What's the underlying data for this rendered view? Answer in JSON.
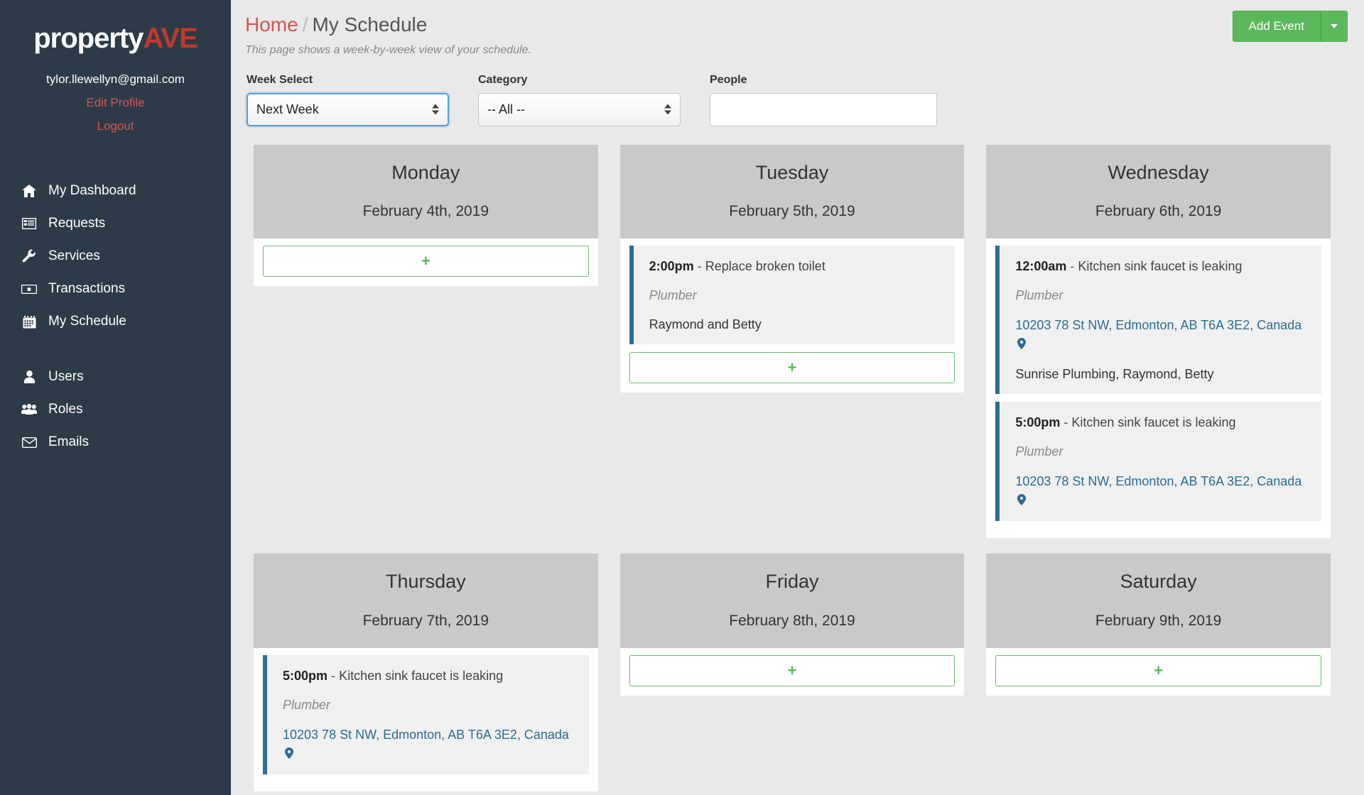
{
  "sidebar": {
    "brand": {
      "part1": "property",
      "part2": "AVE"
    },
    "user_email": "tylor.llewellyn@gmail.com",
    "edit_profile_label": "Edit Profile",
    "logout_label": "Logout",
    "items": [
      {
        "label": "My Dashboard",
        "icon": "home-icon"
      },
      {
        "label": "Requests",
        "icon": "list-alt-icon"
      },
      {
        "label": "Services",
        "icon": "wrench-icon"
      },
      {
        "label": "Transactions",
        "icon": "money-bill-icon"
      },
      {
        "label": "My Schedule",
        "icon": "calendar-icon"
      }
    ],
    "items2": [
      {
        "label": "Users",
        "icon": "user-icon"
      },
      {
        "label": "Roles",
        "icon": "users-icon"
      },
      {
        "label": "Emails",
        "icon": "envelope-icon"
      }
    ]
  },
  "header": {
    "breadcrumb_home": "Home",
    "breadcrumb_sep": "/",
    "breadcrumb_current": "My Schedule",
    "description": "This page shows a week-by-week view of your schedule.",
    "add_event_label": "Add Event"
  },
  "filters": {
    "week_select": {
      "label": "Week Select",
      "value": "Next Week"
    },
    "category": {
      "label": "Category",
      "value": "-- All --"
    },
    "people": {
      "label": "People",
      "value": "",
      "placeholder": ""
    }
  },
  "add_slot_label": "+",
  "colors": {
    "sidebar_bg": "#2d3b48",
    "brand_accent": "#c0392b",
    "link_red": "#d9534f",
    "success_green": "#5cb85c",
    "event_accent": "#2d6e93",
    "day_head_bg": "#c9c9c9",
    "page_bg": "#e9e9e9"
  },
  "days": [
    {
      "name": "Monday",
      "date": "February 4th, 2019",
      "events": [],
      "has_add": true
    },
    {
      "name": "Tuesday",
      "date": "February 5th, 2019",
      "events": [
        {
          "time": "2:00pm",
          "dash": "-",
          "title": "Replace broken toilet",
          "category": "Plumber",
          "address": "",
          "people": "Raymond and Betty"
        }
      ],
      "has_add": true
    },
    {
      "name": "Wednesday",
      "date": "February 6th, 2019",
      "events": [
        {
          "time": "12:00am",
          "dash": "-",
          "title": "Kitchen sink faucet is leaking",
          "category": "Plumber",
          "address": "10203 78 St NW, Edmonton, AB T6A 3E2, Canada",
          "people": "Sunrise Plumbing, Raymond, Betty"
        },
        {
          "time": "5:00pm",
          "dash": "-",
          "title": "Kitchen sink faucet is leaking",
          "category": "Plumber",
          "address": "10203 78 St NW, Edmonton, AB T6A 3E2, Canada",
          "people": ""
        }
      ],
      "has_add": false
    },
    {
      "name": "Thursday",
      "date": "February 7th, 2019",
      "events": [
        {
          "time": "5:00pm",
          "dash": "-",
          "title": "Kitchen sink faucet is leaking",
          "category": "Plumber",
          "address": "10203 78 St NW, Edmonton, AB T6A 3E2, Canada",
          "people": ""
        }
      ],
      "has_add": false
    },
    {
      "name": "Friday",
      "date": "February 8th, 2019",
      "events": [],
      "has_add": true
    },
    {
      "name": "Saturday",
      "date": "February 9th, 2019",
      "events": [],
      "has_add": true
    }
  ]
}
